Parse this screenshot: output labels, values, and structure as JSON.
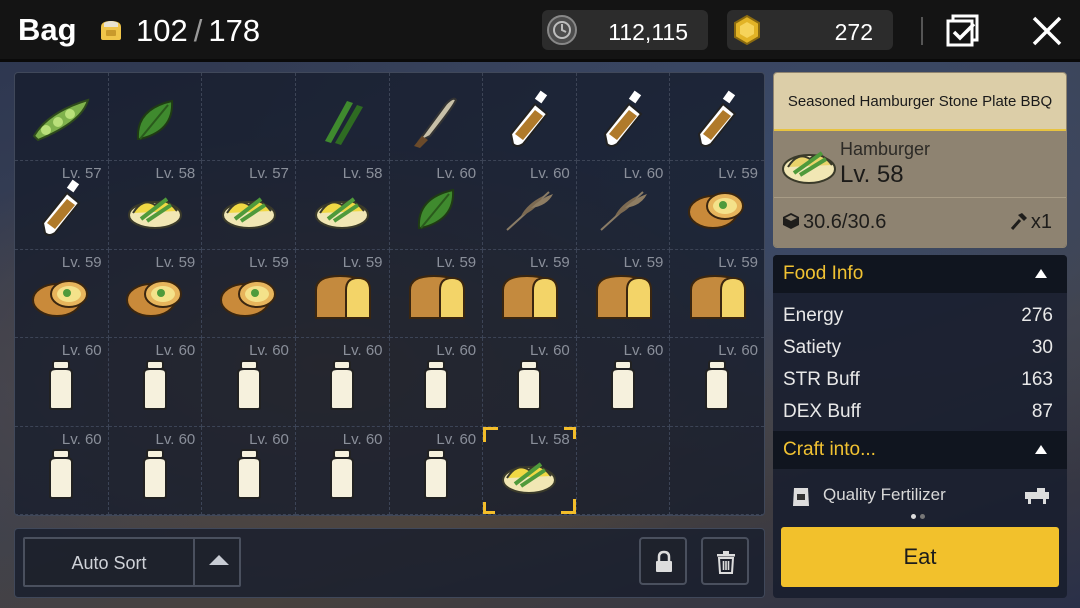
{
  "header": {
    "title": "Bag",
    "capacity_current": "102",
    "capacity_sep": "/",
    "capacity_max": "178",
    "coins": "112,115",
    "gems": "272"
  },
  "grid": {
    "slots": [
      {
        "lv": "",
        "icon": "pea-pod-icon"
      },
      {
        "lv": "",
        "icon": "leaf-icon"
      },
      {
        "lv": "",
        "icon": "empty"
      },
      {
        "lv": "",
        "icon": "green-stalks-icon"
      },
      {
        "lv": "",
        "icon": "knife-icon"
      },
      {
        "lv": "",
        "icon": "sauce-bottle-icon"
      },
      {
        "lv": "",
        "icon": "sauce-bottle-icon"
      },
      {
        "lv": "",
        "icon": "sauce-bottle-icon"
      },
      {
        "lv": "Lv. 57",
        "icon": "sauce-bottle-icon"
      },
      {
        "lv": "Lv. 58",
        "icon": "hamburger-dish-icon"
      },
      {
        "lv": "Lv. 57",
        "icon": "hamburger-dish-icon"
      },
      {
        "lv": "Lv. 58",
        "icon": "hamburger-dish-icon"
      },
      {
        "lv": "Lv. 60",
        "icon": "leaf-icon"
      },
      {
        "lv": "Lv. 60",
        "icon": "wheat-icon"
      },
      {
        "lv": "Lv. 60",
        "icon": "wheat-icon"
      },
      {
        "lv": "Lv. 59",
        "icon": "bun-icon"
      },
      {
        "lv": "Lv. 59",
        "icon": "bun-icon"
      },
      {
        "lv": "Lv. 59",
        "icon": "bun-icon"
      },
      {
        "lv": "Lv. 59",
        "icon": "bun-icon"
      },
      {
        "lv": "Lv. 59",
        "icon": "bread-loaf-icon"
      },
      {
        "lv": "Lv. 59",
        "icon": "bread-loaf-icon"
      },
      {
        "lv": "Lv. 59",
        "icon": "bread-loaf-icon"
      },
      {
        "lv": "Lv. 59",
        "icon": "bread-loaf-icon"
      },
      {
        "lv": "Lv. 59",
        "icon": "bread-loaf-icon"
      },
      {
        "lv": "Lv. 60",
        "icon": "milk-bottle-icon"
      },
      {
        "lv": "Lv. 60",
        "icon": "milk-bottle-icon"
      },
      {
        "lv": "Lv. 60",
        "icon": "milk-bottle-icon"
      },
      {
        "lv": "Lv. 60",
        "icon": "milk-bottle-icon"
      },
      {
        "lv": "Lv. 60",
        "icon": "milk-bottle-icon"
      },
      {
        "lv": "Lv. 60",
        "icon": "milk-bottle-icon"
      },
      {
        "lv": "Lv. 60",
        "icon": "milk-bottle-icon"
      },
      {
        "lv": "Lv. 60",
        "icon": "milk-bottle-icon"
      },
      {
        "lv": "Lv. 60",
        "icon": "milk-bottle-icon"
      },
      {
        "lv": "Lv. 60",
        "icon": "milk-bottle-icon"
      },
      {
        "lv": "Lv. 60",
        "icon": "milk-bottle-icon"
      },
      {
        "lv": "Lv. 60",
        "icon": "milk-bottle-icon"
      },
      {
        "lv": "Lv. 60",
        "icon": "milk-bottle-icon"
      },
      {
        "lv": "Lv. 58",
        "icon": "hamburger-dish-icon",
        "selected": true
      },
      {
        "lv": "",
        "icon": "empty"
      },
      {
        "lv": "",
        "icon": "empty"
      }
    ]
  },
  "bottom": {
    "auto_sort": "Auto Sort"
  },
  "detail": {
    "title": "Seasoned Hamburger Stone Plate BBQ",
    "name": "Hamburger",
    "level": "Lv. 58",
    "weight": "30.6/30.6",
    "tools": "x1"
  },
  "info": {
    "food_info": "Food Info",
    "stats": [
      {
        "label": "Energy",
        "value": "276"
      },
      {
        "label": "Satiety",
        "value": "30"
      },
      {
        "label": "STR Buff",
        "value": "163"
      },
      {
        "label": "DEX Buff",
        "value": "87"
      }
    ],
    "craft_into": "Craft into...",
    "craft_item": "Quality Fertilizer",
    "eat": "Eat"
  },
  "colors": {
    "accent": "#f2c12c",
    "header_bg": "#141414",
    "detail_head": "#dccea8"
  }
}
